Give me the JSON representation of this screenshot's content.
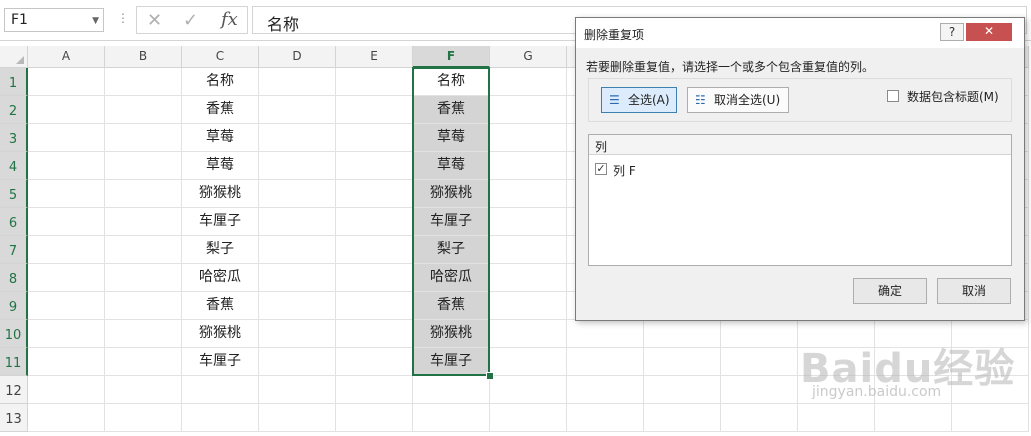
{
  "formula_bar": {
    "name_box": "F1",
    "fx_label": "fx",
    "value": "名称"
  },
  "columns": [
    "A",
    "B",
    "C",
    "D",
    "E",
    "F",
    "G"
  ],
  "rows": [
    "1",
    "2",
    "3",
    "4",
    "5",
    "6",
    "7",
    "8",
    "9",
    "10",
    "11",
    "12",
    "13"
  ],
  "column_c": [
    "名称",
    "香蕉",
    "草莓",
    "草莓",
    "猕猴桃",
    "车厘子",
    "梨子",
    "哈密瓜",
    "香蕉",
    "猕猴桃",
    "车厘子"
  ],
  "column_f": [
    "名称",
    "香蕉",
    "草莓",
    "草莓",
    "猕猴桃",
    "车厘子",
    "梨子",
    "哈密瓜",
    "香蕉",
    "猕猴桃",
    "车厘子"
  ],
  "dialog": {
    "title": "删除重复项",
    "help_label": "?",
    "close_label": "✕",
    "instruction": "若要删除重复值，请选择一个或多个包含重复值的列。",
    "select_all_label": "全选(A)",
    "unselect_all_label": "取消全选(U)",
    "header_checkbox_label": "数据包含标题(M)",
    "list_header": "列",
    "list_items": [
      {
        "label": "列 F",
        "checked": true
      }
    ],
    "ok_label": "确定",
    "cancel_label": "取消"
  },
  "watermark": {
    "logo": "Baidu经验",
    "url": "jingyan.baidu.com"
  },
  "colors": {
    "accent": "#217346",
    "selection_fill": "#d4d4d4",
    "close_button": "#c75050"
  }
}
